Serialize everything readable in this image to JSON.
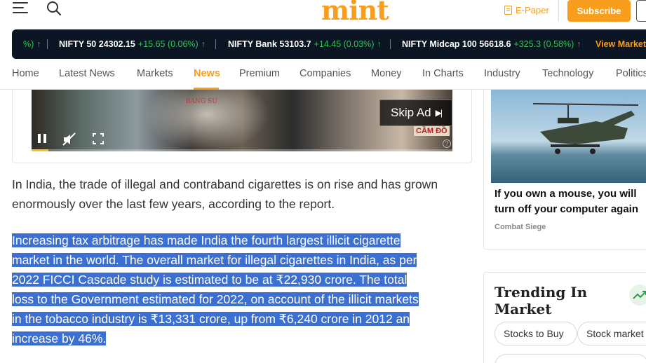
{
  "header": {
    "logo": "mint",
    "epaper_label": "E-Paper",
    "subscribe_label": "Subscribe",
    "brand_color": "#f99d1c"
  },
  "ticker": {
    "items": [
      {
        "name": "NIFTY 50",
        "value": "24302.15",
        "change": "+15.65 (0.06%)",
        "direction": "up"
      },
      {
        "name": "NIFTY Bank",
        "value": "53103.7",
        "change": "+14.45 (0.03%)",
        "direction": "up"
      },
      {
        "name": "NIFTY Midcap 100",
        "value": "56618.6",
        "change": "+325.3 (0.58%)",
        "direction": "up"
      }
    ],
    "leading_fragment": "%)",
    "view_market_label": "View Market",
    "positive_color": "#32c25e"
  },
  "nav": {
    "items": [
      {
        "label": "Home"
      },
      {
        "label": "Latest News"
      },
      {
        "label": "Markets"
      },
      {
        "label": "News",
        "active": true
      },
      {
        "label": "Premium"
      },
      {
        "label": "Companies"
      },
      {
        "label": "Money"
      },
      {
        "label": "In Charts"
      },
      {
        "label": "Industry"
      },
      {
        "label": "Technology"
      },
      {
        "label": "Politics"
      }
    ]
  },
  "video": {
    "skip_label": "Skip Ad",
    "progress_fraction": 0.04,
    "overlay_sign_1": "BANG SU",
    "overlay_sign_2": "CẦM ĐỒ",
    "help_label": "?"
  },
  "article": {
    "paragraph_1": "In India, the trade of illegal and contraband cigarettes is on rise and has grown enormously over the last few years, according to the report.",
    "paragraph_2_lines": [
      "Increasing tax arbitrage has made India the fourth largest illicit cigarette",
      "market in the world. The overall market for illegal cigarettes in India, as per",
      "2022 FICCI Cascade study is estimated to be at ₹22,930 crore. The total",
      "loss to the Government estimated for 2022, on account of the illicit markets",
      "in the tobacco industry is ₹13,331 crore, up from ₹6,240 crore in 2012 an",
      "increase by 46%."
    ],
    "selection_color": "#3b6fd1"
  },
  "sidebar": {
    "ad_title": "If you own a mouse, you will turn off your computer again",
    "ad_source": "Combat Siege",
    "trending_title": "Trending In Market",
    "pills": [
      "Stocks to Buy",
      "Stock market"
    ]
  }
}
